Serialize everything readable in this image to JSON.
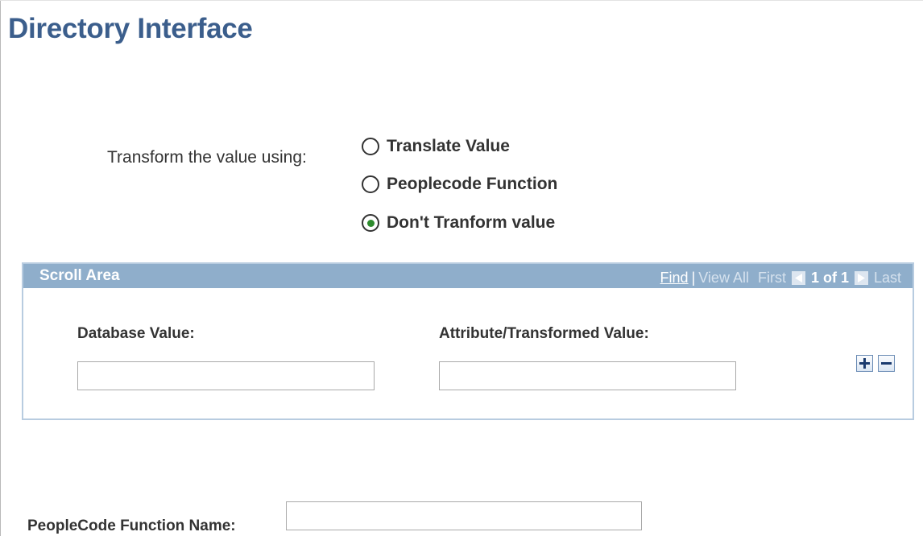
{
  "page": {
    "title": "Directory Interface"
  },
  "transform": {
    "label": "Transform the value using:",
    "options": [
      {
        "label": "Translate Value",
        "checked": false
      },
      {
        "label": "Peoplecode Function",
        "checked": false
      },
      {
        "label": "Don't Tranform value",
        "checked": true
      }
    ]
  },
  "scroll_area": {
    "title": "Scroll Area",
    "nav": {
      "find": "Find",
      "separator": "|",
      "view_all": "View All",
      "first": "First",
      "count": "1 of 1",
      "last": "Last"
    },
    "columns": {
      "database_value": "Database Value:",
      "attribute_value": "Attribute/Transformed Value:"
    },
    "rows": [
      {
        "database_value": "",
        "attribute_value": ""
      }
    ]
  },
  "peoplecode": {
    "label": "PeopleCode Function Name:",
    "value": ""
  },
  "icons": {
    "previous": "left-arrow-icon",
    "next": "right-arrow-icon",
    "add_row": "plus-icon",
    "delete_row": "minus-icon",
    "accent_color": "#3b5e8c",
    "header_color": "#8faecb"
  }
}
